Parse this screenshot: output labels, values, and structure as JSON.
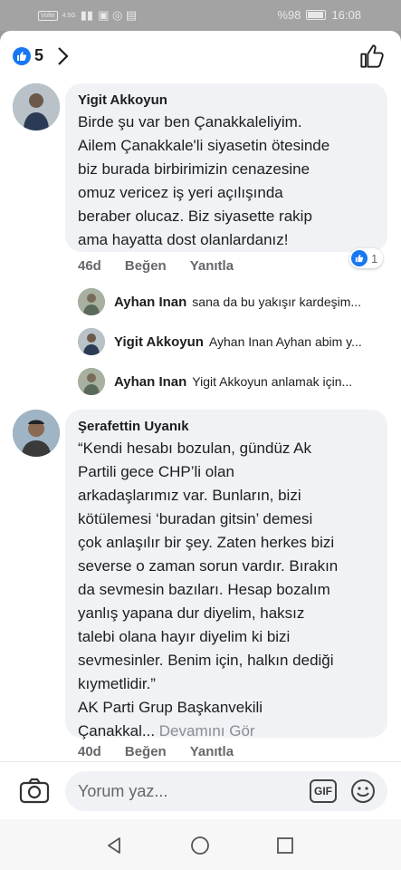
{
  "status": {
    "left_chip": "Volte",
    "left_small": "4.5G",
    "battery": "%98",
    "time": "16:08"
  },
  "header": {
    "like_count": "5",
    "icons": {
      "reaction": "thumbs-up-icon",
      "more": "chevron-right-icon",
      "like_post": "thumbs-up-outline-icon"
    }
  },
  "comments": [
    {
      "author": "Yigit Akkoyun",
      "lines": [
        "Birde şu var ben Çanakkaleliyim.",
        "Ailem Çanakkale'li siyasetin ötesinde",
        "biz burada birbirimizin cenazesine",
        "omuz vericez iş yeri açılışında",
        "beraber olucaz. Biz siyasette rakip",
        "ama hayatta dost olanlardanız!"
      ],
      "time": "46d",
      "like": "Beğen",
      "reply": "Yanıtla",
      "reaction_count": "1"
    },
    {
      "author": "Şerafettin Uyanık",
      "lines": [
        "“Kendi hesabı bozulan, gündüz Ak",
        "Partili gece CHP’li olan",
        "arkadaşlarımız var. Bunların, bizi",
        "kötülemesi ‘buradan gitsin’ demesi",
        "çok anlaşılır bir şey. Zaten herkes bizi",
        "severse o zaman sorun vardır. Bırakın",
        "da sevmesin bazıları. Hesap bozalım",
        "yanlış yapana dur diyelim, haksız",
        "talebi olana hayır diyelim ki bizi",
        "sevmesinler. Benim için, halkın dediği",
        "kıymetlidir.”",
        "AK Parti Grup Başkanvekili"
      ],
      "truncated_tail": "Çanakkal...",
      "see_more": "Devamını Gör",
      "time": "40d",
      "like": "Beğen",
      "reply": "Yanıtla"
    }
  ],
  "replies": [
    {
      "author": "Ayhan Inan",
      "text": "sana da bu yakışır kardeşim..."
    },
    {
      "author": "Yigit Akkoyun",
      "text": "Ayhan Inan Ayhan abim y..."
    },
    {
      "author": "Ayhan Inan",
      "text": "Yigit Akkoyun anlamak için..."
    }
  ],
  "composer": {
    "placeholder": "Yorum yaz...",
    "gif_label": "GIF"
  },
  "colors": {
    "accent": "#1877f2",
    "bubble": "#f0f2f5",
    "meta": "#65676b"
  }
}
